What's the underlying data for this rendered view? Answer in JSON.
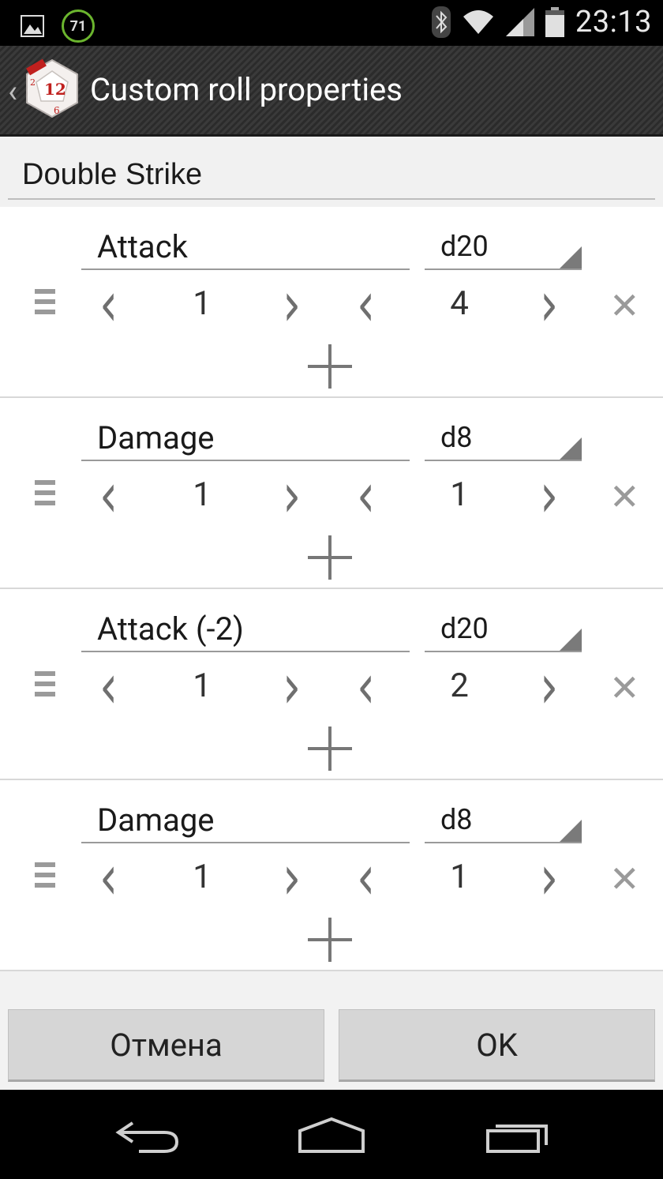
{
  "status_bar": {
    "time": "23:13",
    "badge": "71"
  },
  "action_bar": {
    "title": "Custom roll properties",
    "back_icon": "back-chevron-icon",
    "logo": "d12-dice-logo"
  },
  "roll_name": {
    "value": "Double Strike"
  },
  "rows": [
    {
      "label": "Attack",
      "die": "d20",
      "count": "1",
      "modifier": "4"
    },
    {
      "label": "Damage",
      "die": "d8",
      "count": "1",
      "modifier": "1"
    },
    {
      "label": "Attack (-2)",
      "die": "d20",
      "count": "1",
      "modifier": "2"
    },
    {
      "label": "Damage",
      "die": "d8",
      "count": "1",
      "modifier": "1"
    }
  ],
  "buttons": {
    "cancel": "Отмена",
    "ok": "OK"
  },
  "icons": {
    "prev": "‹",
    "next": "›",
    "remove": "✕"
  },
  "colors": {
    "badge_ring": "#6bb52e",
    "logo_red": "#c0201e"
  }
}
